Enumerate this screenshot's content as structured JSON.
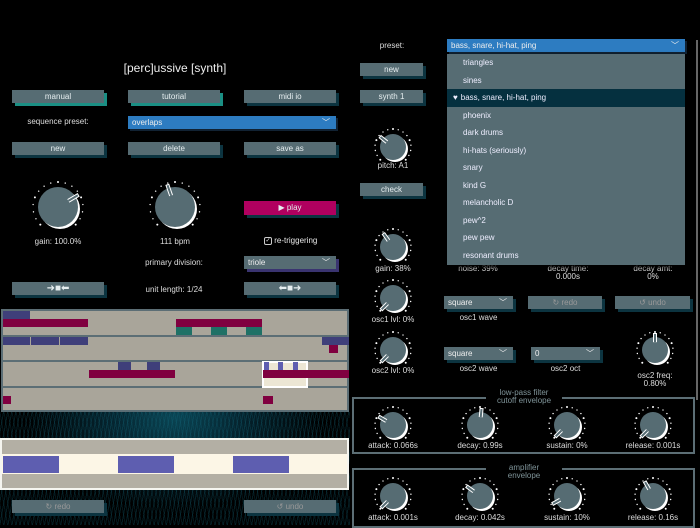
{
  "app": {
    "title": "[perc]ussive [synth]"
  },
  "top_buttons": {
    "manual": "manual",
    "tutorial": "tutorial",
    "midi_io": "midi io"
  },
  "sequence_preset": {
    "label": "sequence preset:",
    "value": "overlaps"
  },
  "sequence_buttons": {
    "new": "new",
    "delete": "delete",
    "save_as": "save as"
  },
  "gain": {
    "label": "gain: 100.0%",
    "value": 0.72
  },
  "tempo": {
    "label": "111 bpm",
    "value": 0.43
  },
  "play": {
    "label": "play",
    "icon": "play-icon",
    "color": "#b0005f"
  },
  "retrigger": {
    "label": "re-triggering",
    "checked": true
  },
  "primary_division": {
    "label": "primary division:",
    "value": "triole"
  },
  "unit_length": {
    "label": "unit length: 1/24"
  },
  "history_left": {
    "redo": "redo",
    "undo": "undo"
  },
  "synth": {
    "preset_label": "preset:",
    "preset_value": "bass, snare, hi-hat, ping",
    "preset_options": [
      "triangles",
      "sines",
      "bass, snare, hi-hat, ping",
      "phoenix",
      "dark drums",
      "hi-hats (seriously)",
      "snary",
      "kind G",
      "melancholic D",
      "pew^2",
      "pew pew",
      "resonant drums"
    ],
    "selected_index": 2,
    "new": "new",
    "synth1": "synth 1",
    "check": "check",
    "pitch": {
      "label": "pitch: A1",
      "value": 0.31
    },
    "gain": {
      "label": "gain: 38%",
      "value": 0.37
    },
    "noise": {
      "label": "noise: 39%"
    },
    "decay_time": {
      "label": "decay time:",
      "value": "0.000s"
    },
    "decay_amt": {
      "label": "decay amt:",
      "value": "0%"
    },
    "osc1_lvl": {
      "label": "osc1 lvl: 0%",
      "value": 0
    },
    "osc1_wave": {
      "label": "osc1 wave",
      "value": "square"
    },
    "redo": "redo",
    "undo": "undo",
    "osc2_lvl": {
      "label": "osc2 lvl: 0%",
      "value": 0
    },
    "osc2_wave": {
      "label": "osc2 wave",
      "value": "square"
    },
    "osc2_oct": {
      "label": "osc2 oct",
      "value": "0"
    },
    "osc2_freq": {
      "label": "osc2 freq:",
      "value": "0.80%",
      "knob": 0.5
    },
    "lpf": {
      "title1": "low-pass filter",
      "title2": "cutoff envelope",
      "knobs": [
        {
          "label": "attack: 0.066s",
          "value": 0.28
        },
        {
          "label": "decay: 0.99s",
          "value": 0.52
        },
        {
          "label": "sustain: 0%",
          "value": 0
        },
        {
          "label": "release: 0.001s",
          "value": 0
        }
      ]
    },
    "amp": {
      "title": "amplifier envelope",
      "knobs": [
        {
          "label": "attack: 0.001s",
          "value": 0
        },
        {
          "label": "decay: 0.042s",
          "value": 0.3
        },
        {
          "label": "sustain: 10%",
          "value": 0.06
        },
        {
          "label": "release: 0.16s",
          "value": 0.39
        }
      ]
    }
  },
  "colors": {
    "accent": "#2d7cc1",
    "panel": "#566c73",
    "note_purple": "#3f3f7a",
    "note_magenta": "#800040",
    "note_teal": "#1f7166"
  }
}
